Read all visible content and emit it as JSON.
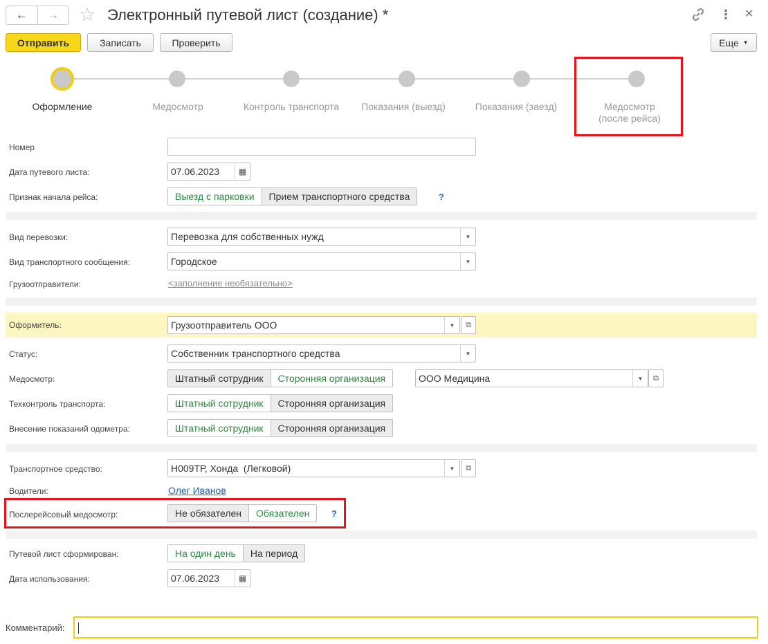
{
  "header": {
    "title": "Электронный путевой лист (создание) *",
    "back_icon": "←",
    "forward_icon": "→"
  },
  "toolbar": {
    "send": "Отправить",
    "save": "Записать",
    "check": "Проверить",
    "more": "Еще"
  },
  "steps": [
    {
      "label": "Оформление",
      "active": true
    },
    {
      "label": "Медосмотр"
    },
    {
      "label": "Контроль транспорта"
    },
    {
      "label": "Показания (выезд)"
    },
    {
      "label": "Показания (заезд)"
    },
    {
      "label": "Медосмотр\n(после рейса)"
    }
  ],
  "form": {
    "number": {
      "label": "Номер",
      "value": ""
    },
    "date": {
      "label": "Дата путевого листа:",
      "value": "07.06.2023"
    },
    "trip_start": {
      "label": "Признак начала рейса:",
      "options": [
        "Выезд с парковки",
        "Прием транспортного средства"
      ],
      "selected": "Выезд с парковки"
    },
    "transport_type": {
      "label": "Вид перевозки:",
      "value": "Перевозка для собственных нужд"
    },
    "transport_msg": {
      "label": "Вид транспортного сообщения:",
      "value": "Городское"
    },
    "shippers": {
      "label": "Грузоотправители:",
      "value": "<заполнение необязательно>"
    },
    "issuer": {
      "label": "Оформитель:",
      "value": "Грузоотправитель ООО"
    },
    "status": {
      "label": "Статус:",
      "value": "Собственник транспортного средства"
    },
    "medcheck": {
      "label": "Медосмотр:",
      "options": [
        "Штатный сотрудник",
        "Сторонняя организация"
      ],
      "selected": "Сторонняя организация",
      "org": "ООО Медицина"
    },
    "techcontrol": {
      "label": "Техконтроль транспорта:",
      "options": [
        "Штатный сотрудник",
        "Сторонняя организация"
      ],
      "selected": "Штатный сотрудник"
    },
    "odometer": {
      "label": "Внесение показаний одометра:",
      "options": [
        "Штатный сотрудник",
        "Сторонняя организация"
      ],
      "selected": "Штатный сотрудник"
    },
    "vehicle": {
      "label": "Транспортное средство:",
      "value": "Н009ТР, Хонда  (Легковой)"
    },
    "drivers": {
      "label": "Водители:",
      "value": "Олег Иванов"
    },
    "post_medcheck": {
      "label": "Послерейсовый медосмотр:",
      "options": [
        "Не обязателен",
        "Обязателен"
      ],
      "selected": "Обязателен"
    },
    "formed": {
      "label": "Путевой лист сформирован:",
      "options": [
        "На один день",
        "На период"
      ],
      "selected": "На один день"
    },
    "use_date": {
      "label": "Дата использования:",
      "value": "07.06.2023"
    },
    "comment": {
      "label": "Комментарий:",
      "value": ""
    }
  },
  "colors": {
    "accent_yellow": "#f7d718",
    "selected_green": "#2b8b3f",
    "highlight_red": "#e8121b",
    "link_blue": "#1e6cbe"
  }
}
